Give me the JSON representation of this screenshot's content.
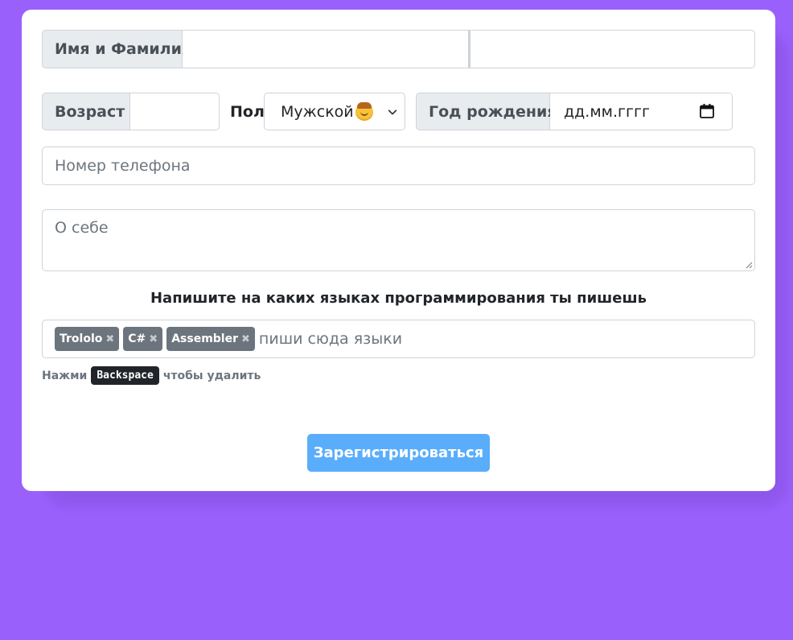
{
  "form": {
    "name_label": "Имя и Фамилия",
    "first_name_value": "",
    "last_name_value": "",
    "age_label": "Возраст",
    "age_value": "",
    "gender_label": "Пол",
    "gender_selected": "Мужской",
    "gender_emoji_icon": "man-face-emoji",
    "birth_label": "Год рождения",
    "birth_placeholder": "дд.мм.гггг",
    "phone_placeholder": "Номер телефона",
    "about_placeholder": "О себе",
    "languages_heading": "Напишите на каких языках программирования ты пишешь",
    "tags": [
      "Trololo",
      "C#",
      "Assembler"
    ],
    "tag_remove_glyph": "✖",
    "tags_placeholder": "пиши сюда языки",
    "hint_prefix": "Нажми",
    "hint_key": "Backspace",
    "hint_suffix": "чтобы удалить",
    "submit_label": "Зарегистрироваться"
  },
  "colors": {
    "background": "#9a60fc",
    "card": "#ffffff",
    "addon_bg": "#e9ecef",
    "border": "#ced4da",
    "tag_bg": "#6c757d",
    "button_bg": "#5aadfb"
  }
}
